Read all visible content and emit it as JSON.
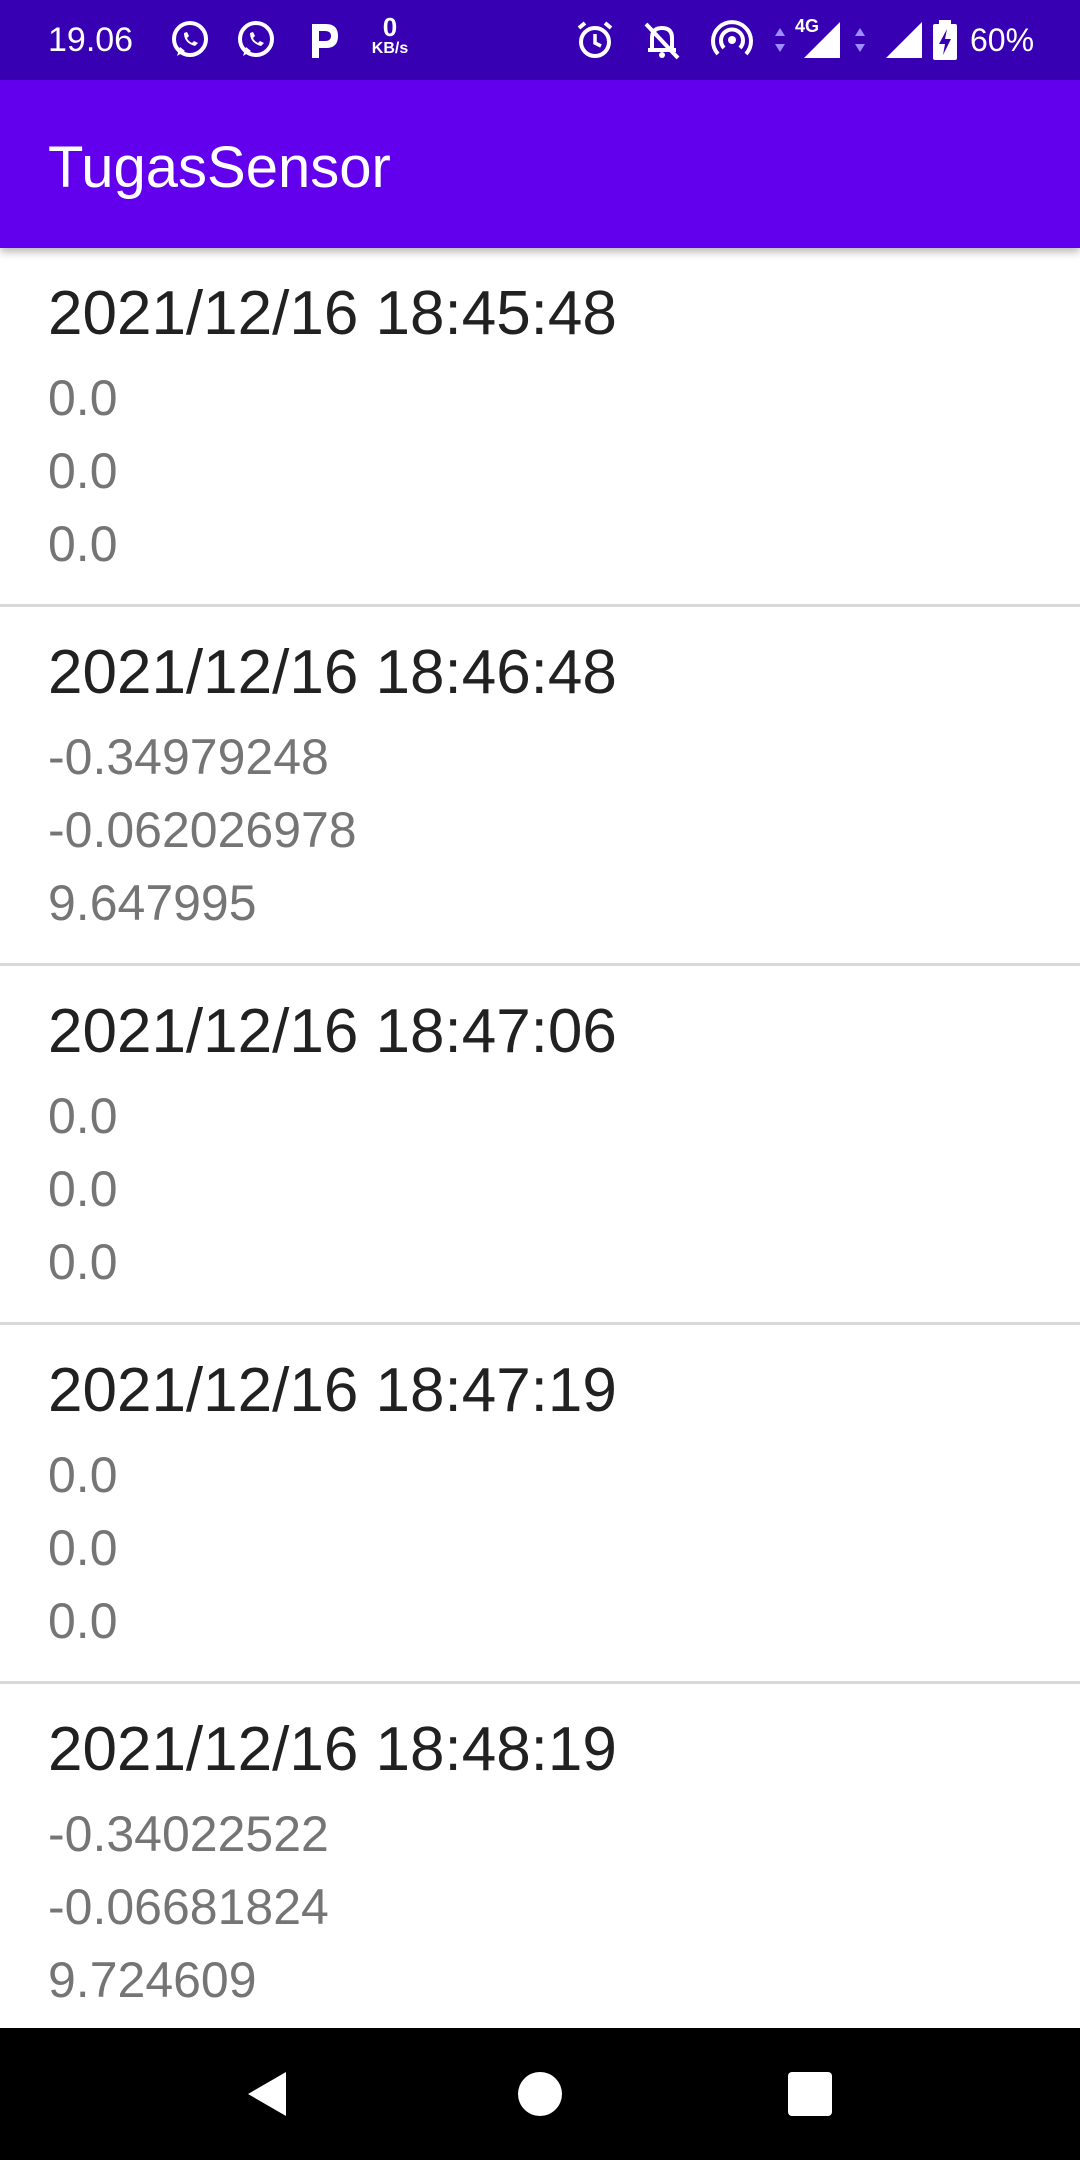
{
  "status_bar": {
    "time": "19.06",
    "net_speed_value": "0",
    "net_speed_unit": "KB/s",
    "network_type": "4G",
    "battery_percent": "60%",
    "background_color": "#3700b3",
    "left_icons": [
      "whatsapp-icon",
      "whatsapp-business-icon",
      "parking-p-icon"
    ],
    "right_icons": [
      "alarm-icon",
      "notifications-off-icon",
      "hotspot-icon",
      "signal-icon",
      "signal-icon",
      "battery-charging-icon"
    ]
  },
  "app_bar": {
    "title": "TugasSensor",
    "background_color": "#6200ee"
  },
  "list": {
    "items": [
      {
        "timestamp": "2021/12/16 18:45:48",
        "values": [
          "0.0",
          "0.0",
          "0.0"
        ]
      },
      {
        "timestamp": "2021/12/16 18:46:48",
        "values": [
          "-0.34979248",
          "-0.062026978",
          "9.647995"
        ]
      },
      {
        "timestamp": "2021/12/16 18:47:06",
        "values": [
          "0.0",
          "0.0",
          "0.0"
        ]
      },
      {
        "timestamp": "2021/12/16 18:47:19",
        "values": [
          "0.0",
          "0.0",
          "0.0"
        ]
      },
      {
        "timestamp": "2021/12/16 18:48:19",
        "values": [
          "-0.34022522",
          "-0.06681824",
          "9.724609"
        ]
      }
    ]
  },
  "nav_bar": {
    "buttons": [
      "back-icon",
      "home-icon",
      "recents-icon"
    ]
  }
}
